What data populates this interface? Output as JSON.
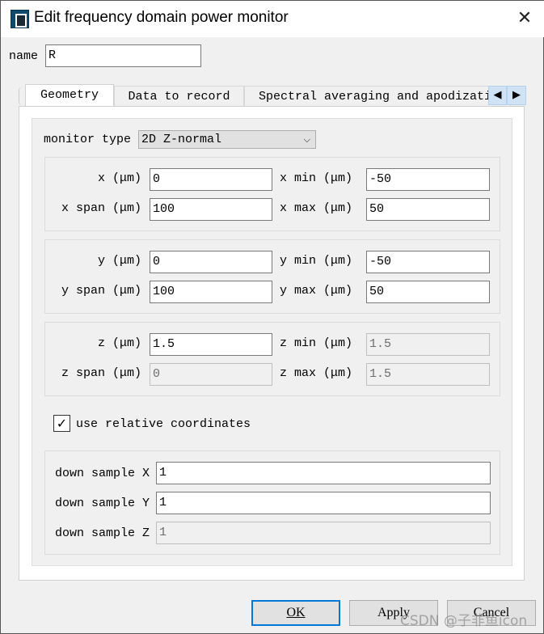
{
  "window": {
    "title": "Edit frequency domain power monitor",
    "close_icon": "close-icon"
  },
  "name": {
    "label": "name",
    "value": "R"
  },
  "tabs": [
    {
      "label": "Geometry",
      "active": true
    },
    {
      "label": "Data to record"
    },
    {
      "label": "Spectral averaging and apodization"
    }
  ],
  "monitor_type": {
    "label": "monitor type",
    "value": "2D Z-normal"
  },
  "x": {
    "x_label": "x (μm)",
    "x": "0",
    "span_label": "x span (μm)",
    "span": "100",
    "min_label": "x min (μm)",
    "min": "-50",
    "max_label": "x max (μm)",
    "max": "50"
  },
  "y": {
    "y_label": "y (μm)",
    "y": "0",
    "span_label": "y span (μm)",
    "span": "100",
    "min_label": "y min (μm)",
    "min": "-50",
    "max_label": "y max (μm)",
    "max": "50"
  },
  "z": {
    "z_label": "z (μm)",
    "z": "1.5",
    "span_label": "z span (μm)",
    "span": "0",
    "min_label": "z min (μm)",
    "min": "1.5",
    "max_label": "z max (μm)",
    "max": "1.5"
  },
  "relative": {
    "label": "use relative coordinates",
    "checked": true
  },
  "downsample": {
    "x_label": "down sample X",
    "x": "1",
    "y_label": "down sample Y",
    "y": "1",
    "z_label": "down sample Z",
    "z": "1"
  },
  "buttons": {
    "ok": "OK",
    "apply": "Apply",
    "cancel": "Cancel"
  },
  "watermark": "CSDN @子非鱼icon",
  "colors": {
    "accent": "#0078d7"
  }
}
